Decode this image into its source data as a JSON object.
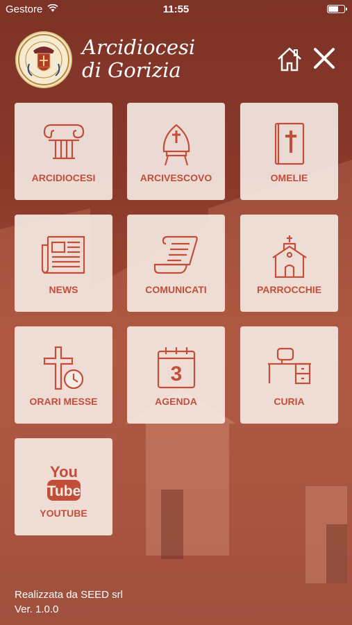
{
  "status_bar": {
    "carrier": "Gestore",
    "time": "11:55"
  },
  "header": {
    "title_line1": "Arcidiocesi",
    "title_line2": "di Gorizia"
  },
  "menu": [
    {
      "label": "ARCIDIOCESI",
      "icon": "column-icon"
    },
    {
      "label": "ARCIVESCOVO",
      "icon": "mitre-icon"
    },
    {
      "label": "OMELIE",
      "icon": "bible-icon"
    },
    {
      "label": "NEWS",
      "icon": "newspaper-icon"
    },
    {
      "label": "COMUNICATI",
      "icon": "scroll-icon"
    },
    {
      "label": "PARROCCHIE",
      "icon": "church-icon"
    },
    {
      "label": "ORARI MESSE",
      "icon": "cross-clock-icon"
    },
    {
      "label": "AGENDA",
      "icon": "calendar-icon"
    },
    {
      "label": "CURIA",
      "icon": "desk-icon"
    },
    {
      "label": "YOUTUBE",
      "icon": "youtube-icon"
    }
  ],
  "icon_texts": {
    "agenda_day": "3",
    "youtube_you": "You",
    "youtube_tube": "Tube"
  },
  "colors": {
    "accent": "#c24e3a",
    "tile_bg": "#f6ece6"
  },
  "footer": {
    "credit_prefix": "Realizzata da ",
    "credit_company": "SEED srl",
    "version": "Ver. 1.0.0"
  }
}
